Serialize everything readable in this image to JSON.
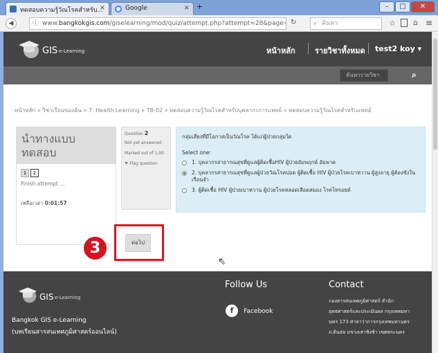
{
  "browser": {
    "tabs": [
      {
        "label": "ทดสอบความรู้วัณโรคสำหรับ...",
        "close": "×",
        "active": true
      },
      {
        "label": "Google",
        "close": "×",
        "active": false
      }
    ],
    "new_tab": "+",
    "window_buttons": [
      "–",
      "□",
      "✕"
    ],
    "url_prefix": "www.",
    "url_host": "bangkokgis.com",
    "url_path": "/giselearning/mod/quiz/attempt.php?attempt=28&page=1",
    "search_placeholder": "ค้นหา",
    "icons": [
      "back-arrow-icon",
      "info-icon",
      "reload-icon",
      "search-icon",
      "star-icon",
      "reading-list-icon",
      "home-icon",
      "menu-icon"
    ]
  },
  "site": {
    "logo_text": "GIS",
    "logo_sub": "e-Learning",
    "nav": [
      "หน้าหลัก",
      "รายวิชาทั้งหมด"
    ],
    "user_menu": "test2 koy",
    "course_search_placeholder": "ค้นหารายวิชา"
  },
  "breadcrumb": [
    "หน้าหลัก",
    "วิชาเรียนของฉัน",
    "7. Health Learning",
    "TB-02",
    "ทดสอบความรู้วัณโรคสำหรับบุคลากรการแพทย์",
    "ทดสอบความรู้วัณโรคสำหรับแพทย์"
  ],
  "breadcrumb_sep": "»",
  "quiz_nav": {
    "title_line1": "นำทางแบบ",
    "title_line2": "ทดสอบ",
    "pages": [
      "1",
      "2"
    ],
    "finish": "Finish attempt ...",
    "time_label": "เหลือเวลา",
    "time_value": "0:01:57"
  },
  "question_info": {
    "label": "Question",
    "number": "2",
    "status": "Not yet answered",
    "marked": "Marked out of 1.00",
    "flag": "Flag question"
  },
  "question": {
    "text": "กลุ่มเสี่ยงที่มีโอกาสเป็นวัณโรค ได้แก่ผู้ป่วยกลุ่มใด",
    "select_one": "Select one:",
    "options": [
      {
        "label": "1. บุคลากรสาธารณสุขที่ดูแลผู้ติดเชื้อHIV ผู้ป่วยอัมพฤกษ์ อัมพาต",
        "selected": false
      },
      {
        "label": "2. บุคลากรสาธารณสุขที่ดูแลผู้ป่วยวัณโรคปอด ผู้ติดเชื้อ HIV ผู้ป่วยโรคเบาหวาน ผู้สูงอายุ ผู้ต้องขังในเรือนจำ",
        "selected": true
      },
      {
        "label": "3. ผู้ติดเชื้อ HIV ผู้ป่วยเบาหวาน ผู้ป่วยโรคหลอดเลือดสมอง โรคไทรอยด์",
        "selected": false
      }
    ]
  },
  "next_button": "ต่อไป",
  "annotation_number": "3",
  "footer": {
    "logo_text": "GIS",
    "logo_sub": "e-Learning",
    "site_name": "Bangkok GIS e-Learning",
    "site_sub": "(บทเรียนสารสนเทศภูมิศาสตร์ออนไลน์)",
    "follow_title": "Follow Us",
    "facebook": "Facebook",
    "contact_title": "Contact",
    "contact_lines": [
      "กองสารสนเทศภูมิศาสตร์ สำนัก",
      "ยุทธศาสตร์และประเมินผล กรุงเทพมหา",
      "นคร 173 ศาลาว่าการกรุงเทพมหานคร",
      "ถ.ดินสอ แขวงเสาชิงช้า เขตพระนคร"
    ]
  },
  "colors": {
    "header": "#444444",
    "subbar": "#666666",
    "question_bg": "#dbeef6",
    "annotation_red": "#e0141e"
  }
}
